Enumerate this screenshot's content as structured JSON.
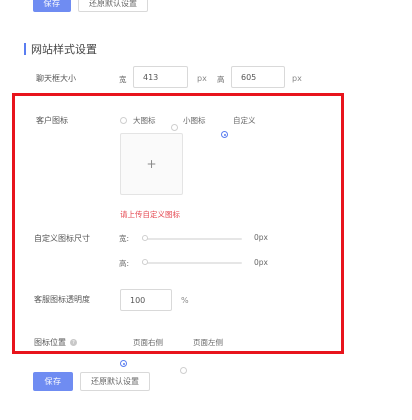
{
  "top_buttons": {
    "save": "保存",
    "reset": "还原默认设置"
  },
  "section": {
    "title": "网站样式设置"
  },
  "chat_box_size": {
    "label": "聊天框大小",
    "width_label": "宽",
    "width_value": "413",
    "width_unit": "px",
    "height_label": "高",
    "height_value": "605",
    "height_unit": "px"
  },
  "customer_icon": {
    "label": "客户图标",
    "options": [
      "大图标",
      "小图标",
      "自定义"
    ],
    "selected": "自定义",
    "upload_symbol": "+",
    "warning": "请上传自定义图标"
  },
  "custom_icon_size": {
    "label": "自定义图标尺寸",
    "width_label": "宽:",
    "width_value": "0px",
    "height_label": "高:",
    "height_value": "0px"
  },
  "opacity": {
    "label": "客服图标透明度",
    "value": "100",
    "unit": "%"
  },
  "icon_position": {
    "label": "图标位置",
    "help_icon": "?",
    "options": [
      "页面右侧",
      "页面左侧"
    ],
    "selected": "页面右侧"
  },
  "bottom_buttons": {
    "save": "保存",
    "reset": "还原默认设置"
  },
  "colors": {
    "primary": "#6f8cf2",
    "accent": "#5a7df0",
    "highlight": "#e8141c",
    "warning": "#e5464f"
  }
}
